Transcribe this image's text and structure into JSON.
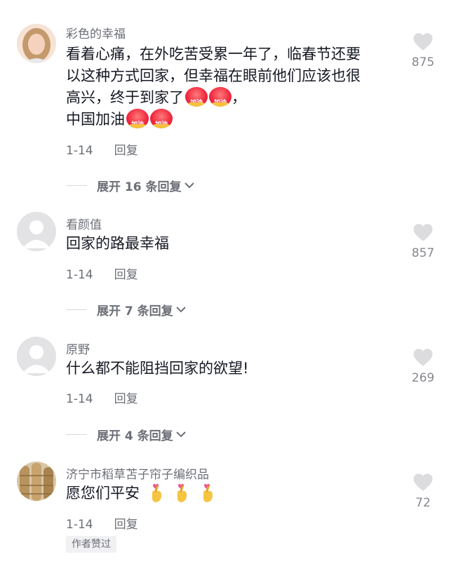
{
  "comments": [
    {
      "username": "彩色的幸福",
      "text_lines": [
        "看着心痛，在外吃苦受累一年了，临春节还要",
        "以这种方式回家，但幸福在眼前他们应该也很",
        "高兴，终于到家了",
        "中国加油"
      ],
      "line3_suffix": "，",
      "badge_label": "加油",
      "date": "1-14",
      "reply_label": "回复",
      "like_count": "875",
      "expand_label": "展开 16 条回复"
    },
    {
      "username": "看颜值",
      "text_lines": [
        "回家的路最幸福"
      ],
      "date": "1-14",
      "reply_label": "回复",
      "like_count": "857",
      "expand_label": "展开 7 条回复"
    },
    {
      "username": "原野",
      "text_lines": [
        "什么都不能阻挡回家的欲望!"
      ],
      "date": "1-14",
      "reply_label": "回复",
      "like_count": "269",
      "expand_label": "展开 4 条回复"
    },
    {
      "username": "济宁市稻草苫子帘子编织品",
      "text_lines": [
        "愿您们平安"
      ],
      "date": "1-14",
      "reply_label": "回复",
      "like_count": "72",
      "author_liked": "作者赞过"
    }
  ],
  "colors": {
    "text": "#161823",
    "secondary": "#6b6e76",
    "heart": "#dcdcdf"
  },
  "icons": [
    "heart-icon",
    "chevron-down-icon",
    "jiayou-sticker",
    "finger-heart-emoji"
  ]
}
